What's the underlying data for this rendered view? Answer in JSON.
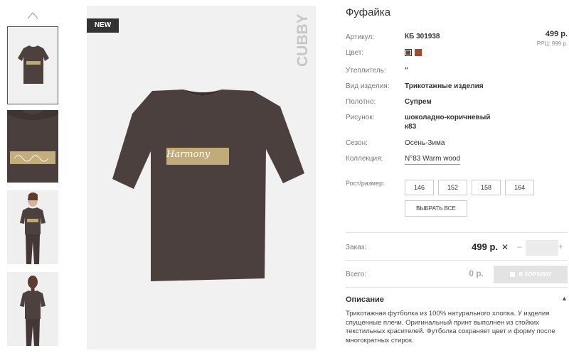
{
  "gallery": {
    "badge": "NEW",
    "brand": "CUBBY",
    "print_text": "Harmony"
  },
  "product": {
    "title": "Фуфайка",
    "price": "499 р.",
    "rrp": "РРЦ: 999 р.",
    "attributes": [
      {
        "label": "Артикул:",
        "value": "КБ 301938"
      },
      {
        "label": "Цвет:",
        "value": ""
      },
      {
        "label": "Утеплитель:",
        "value": "\""
      },
      {
        "label": "Вид изделия:",
        "value": "Трикотажные изделия"
      },
      {
        "label": "Полотно:",
        "value": "Супрем"
      },
      {
        "label": "Рисунок:",
        "value": "шоколадно-коричневый к83"
      },
      {
        "label": "Сезон:",
        "value": "Осень-Зима"
      },
      {
        "label": "Коллекция:",
        "value": "N°83 Warm wood"
      }
    ],
    "colors": [
      "#6e4636",
      "#a14a32"
    ],
    "size_label": "Рост/размер:",
    "sizes": [
      "146",
      "152",
      "158",
      "164"
    ],
    "select_all": "ВЫБРАТЬ ВСЕ"
  },
  "order": {
    "label": "Заказ:",
    "price": "499 р.",
    "times": "✕",
    "minus": "–",
    "plus": "+",
    "qty": ""
  },
  "total": {
    "label": "Всего:",
    "price": "0 р.",
    "cart_button": "В КОРЗИНУ"
  },
  "description": {
    "heading": "Описание",
    "text": "Трикотажная футболка из 100% натурального хлопка. У изделия спущенные плечи. Оригинальный принт выполнен из стойких текстильных красителей. Футболка сохраняет цвет и форму после многократных стирок."
  }
}
